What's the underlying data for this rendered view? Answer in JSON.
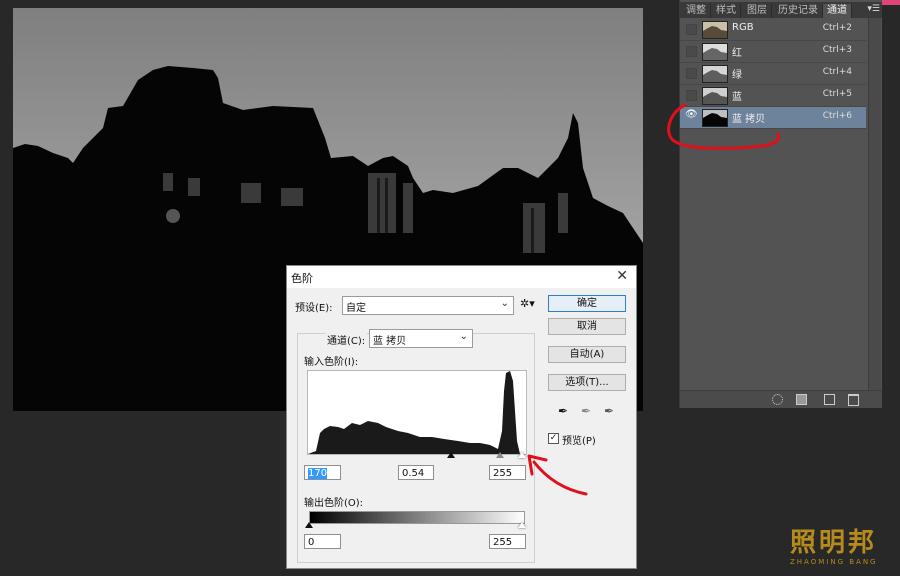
{
  "panel": {
    "tabs": [
      "调整",
      "样式",
      "图层",
      "历史记录",
      "通道"
    ],
    "active_tab": "通道",
    "menu_icon": "panel-menu-icon",
    "channels": [
      {
        "name": "RGB",
        "shortcut": "Ctrl+2",
        "visible": false,
        "selected": false
      },
      {
        "name": "红",
        "shortcut": "Ctrl+3",
        "visible": false,
        "selected": false
      },
      {
        "name": "绿",
        "shortcut": "Ctrl+4",
        "visible": false,
        "selected": false
      },
      {
        "name": "蓝",
        "shortcut": "Ctrl+5",
        "visible": false,
        "selected": false
      },
      {
        "name": "蓝 拷贝",
        "shortcut": "Ctrl+6",
        "visible": true,
        "selected": true
      }
    ],
    "footer_icons": [
      "load-selection-icon",
      "save-selection-icon",
      "new-channel-icon",
      "delete-channel-icon"
    ]
  },
  "dialog": {
    "title": "色阶",
    "close": "✕",
    "preset_label": "预设(E):",
    "preset_value": "自定",
    "channel_label": "通道(C):",
    "channel_value": "蓝 拷贝",
    "input_levels_label": "输入色阶(I):",
    "input_black": "170",
    "input_gamma": "0.54",
    "input_white": "255",
    "output_levels_label": "输出色阶(O):",
    "output_black": "0",
    "output_white": "255",
    "buttons": {
      "ok": "确定",
      "cancel": "取消",
      "auto": "自动(A)",
      "options": "选项(T)..."
    },
    "preview_label": "预览(P)",
    "preview_checked": true
  },
  "watermark": {
    "main": "照明邦",
    "sub": "ZHAOMING BANG"
  },
  "colors": {
    "annotation_red": "#e0101a",
    "selected_row": "#6d839b",
    "watermark": "#b58b1e"
  }
}
